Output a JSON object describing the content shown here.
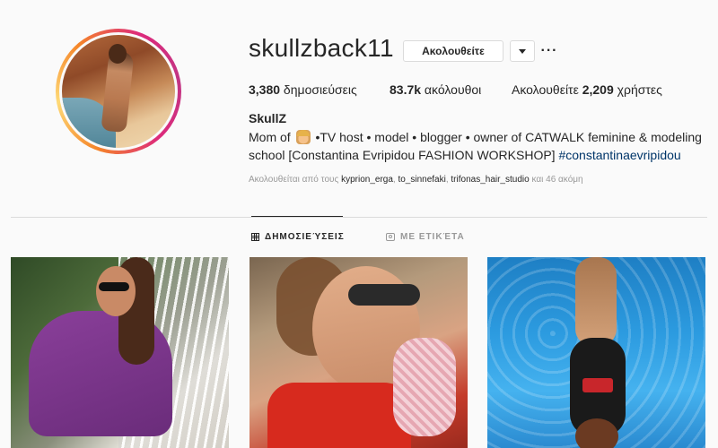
{
  "profile": {
    "username": "skullzback11",
    "follow_label": "Ακολουθείτε",
    "more_label": "···",
    "stats": {
      "posts_value": "3,380",
      "posts_label": " δημοσιεύσεις",
      "followers_value": "83.7k",
      "followers_label": " ακόλουθοι",
      "following_prefix": "Ακολουθείτε ",
      "following_value": "2,209",
      "following_label": " χρήστες"
    },
    "bio": {
      "name": "SkullZ",
      "line1_before_emoji": "Mom of ",
      "emoji": "baby-face-emoji",
      "line1_after_emoji": " •TV host • model • blogger • owner of CATWALK feminine & modeling",
      "line2_text": "school [Constantina Evripidou FASHION WORKSHOP] ",
      "hashtag": "#constantinaevripidou"
    },
    "followed_by": {
      "prefix": "Ακολουθείται από τους ",
      "users": [
        "kyprion_erga",
        "to_sinnefaki",
        "trifonas_hair_studio"
      ],
      "suffix": "και 46 ακόμη"
    }
  },
  "tabs": [
    {
      "label": "ΔΗΜΟΣΙΕΎΣΕΙΣ",
      "icon": "grid-icon",
      "active": true
    },
    {
      "label": "ΜΕ ΕΤΙΚΈΤΑ",
      "icon": "tag-icon",
      "active": false
    }
  ],
  "colors": {
    "accent_link": "#003569",
    "ring_start": "#f58529",
    "ring_end": "#dd2a7b"
  }
}
